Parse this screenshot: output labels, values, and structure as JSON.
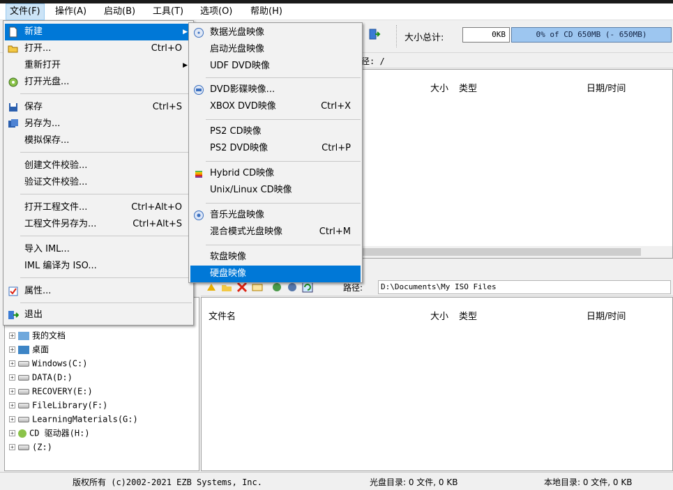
{
  "menubar": {
    "items": [
      "文件(F)",
      "操作(A)",
      "启动(B)",
      "工具(T)",
      "选项(O)",
      "帮助(H)"
    ]
  },
  "toolbar": {
    "size_label": "大小总计:",
    "size_value": "0KB",
    "cd_capacity": "0% of CD 650MB (- 650MB)"
  },
  "upper_pane": {
    "path_label": "径: /",
    "columns": {
      "size": "大小",
      "type": "类型",
      "date": "日期/时间"
    }
  },
  "lower_pane": {
    "path_label": "路径:",
    "path_value": "D:\\Documents\\My ISO Files",
    "columns": {
      "name": "文件名",
      "size": "大小",
      "type": "类型",
      "date": "日期/时间"
    }
  },
  "tree": {
    "items": [
      "我的文档",
      "桌面",
      "Windows(C:)",
      "DATA(D:)",
      "RECOVERY(E:)",
      "FileLibrary(F:)",
      "LearningMaterials(G:)",
      "CD 驱动器(H:)",
      "(Z:)"
    ]
  },
  "status": {
    "copyright": "版权所有 (c)2002-2021 EZB Systems, Inc.",
    "disc_dir": "光盘目录: 0 文件, 0 KB",
    "local_dir": "本地目录: 0 文件, 0 KB"
  },
  "file_menu": {
    "new": "新建",
    "open": "打开...",
    "open_sc": "Ctrl+O",
    "reopen": "重新打开",
    "open_disc": "打开光盘...",
    "save": "保存",
    "save_sc": "Ctrl+S",
    "save_as": "另存为...",
    "sim_save": "模拟保存...",
    "create_checksum": "创建文件校验...",
    "verify_checksum": "验证文件校验...",
    "open_project": "打开工程文件...",
    "open_project_sc": "Ctrl+Alt+O",
    "save_project_as": "工程文件另存为...",
    "save_project_as_sc": "Ctrl+Alt+S",
    "import_iml": "导入 IML...",
    "iml_to_iso": "IML 编译为 ISO...",
    "properties": "属性...",
    "exit": "退出"
  },
  "new_submenu": {
    "data_disc": "数据光盘映像",
    "boot_disc": "启动光盘映像",
    "udf_dvd": "UDF DVD映像",
    "dvd_video": "DVD影碟映像...",
    "xbox_dvd": "XBOX DVD映像",
    "xbox_dvd_sc": "Ctrl+X",
    "ps2_cd": "PS2 CD映像",
    "ps2_dvd": "PS2 DVD映像",
    "ps2_dvd_sc": "Ctrl+P",
    "hybrid_cd": "Hybrid CD映像",
    "unix_cd": "Unix/Linux CD映像",
    "audio_disc": "音乐光盘映像",
    "mixed_mode": "混合模式光盘映像",
    "mixed_mode_sc": "Ctrl+M",
    "floppy": "软盘映像",
    "hard_disk": "硬盘映像"
  },
  "colors": {
    "highlight": "#0078d7",
    "menu_bg": "#f2f2f2",
    "cd_bar": "#9dc6f0"
  }
}
